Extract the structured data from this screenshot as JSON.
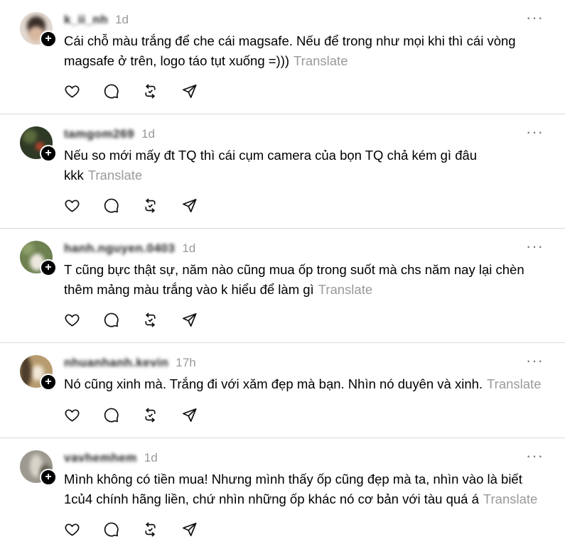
{
  "posts": [
    {
      "username": "k_ii_nh",
      "time": "1d",
      "text": "Cái chỗ màu trắng để che cái magsafe. Nếu để trong như mọi khi thì cái vòng magsafe ở trên, logo táo tụt xuống =)))",
      "translate": "Translate",
      "avatar_colors": [
        "#d9c7b8",
        "#3a2d28"
      ]
    },
    {
      "username": "tamgom269",
      "time": "1d",
      "text": "Nếu so mới mấy đt TQ thì cái cụm camera của bọn TQ chả kém gì đâu kkk",
      "translate": "Translate",
      "avatar_colors": [
        "#3d4a2e",
        "#a33a2a"
      ]
    },
    {
      "username": "hanh.nguyen.0403",
      "time": "1d",
      "text": "T cũng bực thật sự, năm nào cũng mua ốp trong suốt mà chs năm nay lại chèn thêm mảng màu trắng vào k hiểu để làm gì",
      "translate": "Translate",
      "avatar_colors": [
        "#7a8c5a",
        "#e8e4dc"
      ]
    },
    {
      "username": "nhuanhanh.kevin",
      "time": "17h",
      "text": "Nó cũng xinh mà. Trắng đi với xăm đẹp mà bạn. Nhìn nó duyên và xinh.",
      "translate": "Translate",
      "avatar_colors": [
        "#c9b089",
        "#5a4a36"
      ]
    },
    {
      "username": "vavhemhem",
      "time": "1d",
      "text": "Mình không có tiền mua! Nhưng mình thấy ốp cũng đẹp mà ta, nhìn vào là biết 1củ4 chính hãng liền, chứ nhìn những ốp khác nó cơ bản với tàu quá á",
      "translate": "Translate",
      "avatar_colors": [
        "#a8a8a0",
        "#6f6a5e"
      ]
    }
  ],
  "icons": [
    "heart-icon",
    "comment-icon",
    "repost-icon",
    "share-icon",
    "more-icon",
    "follow-plus-icon"
  ],
  "more_glyph": "···",
  "badge_glyph": "+"
}
